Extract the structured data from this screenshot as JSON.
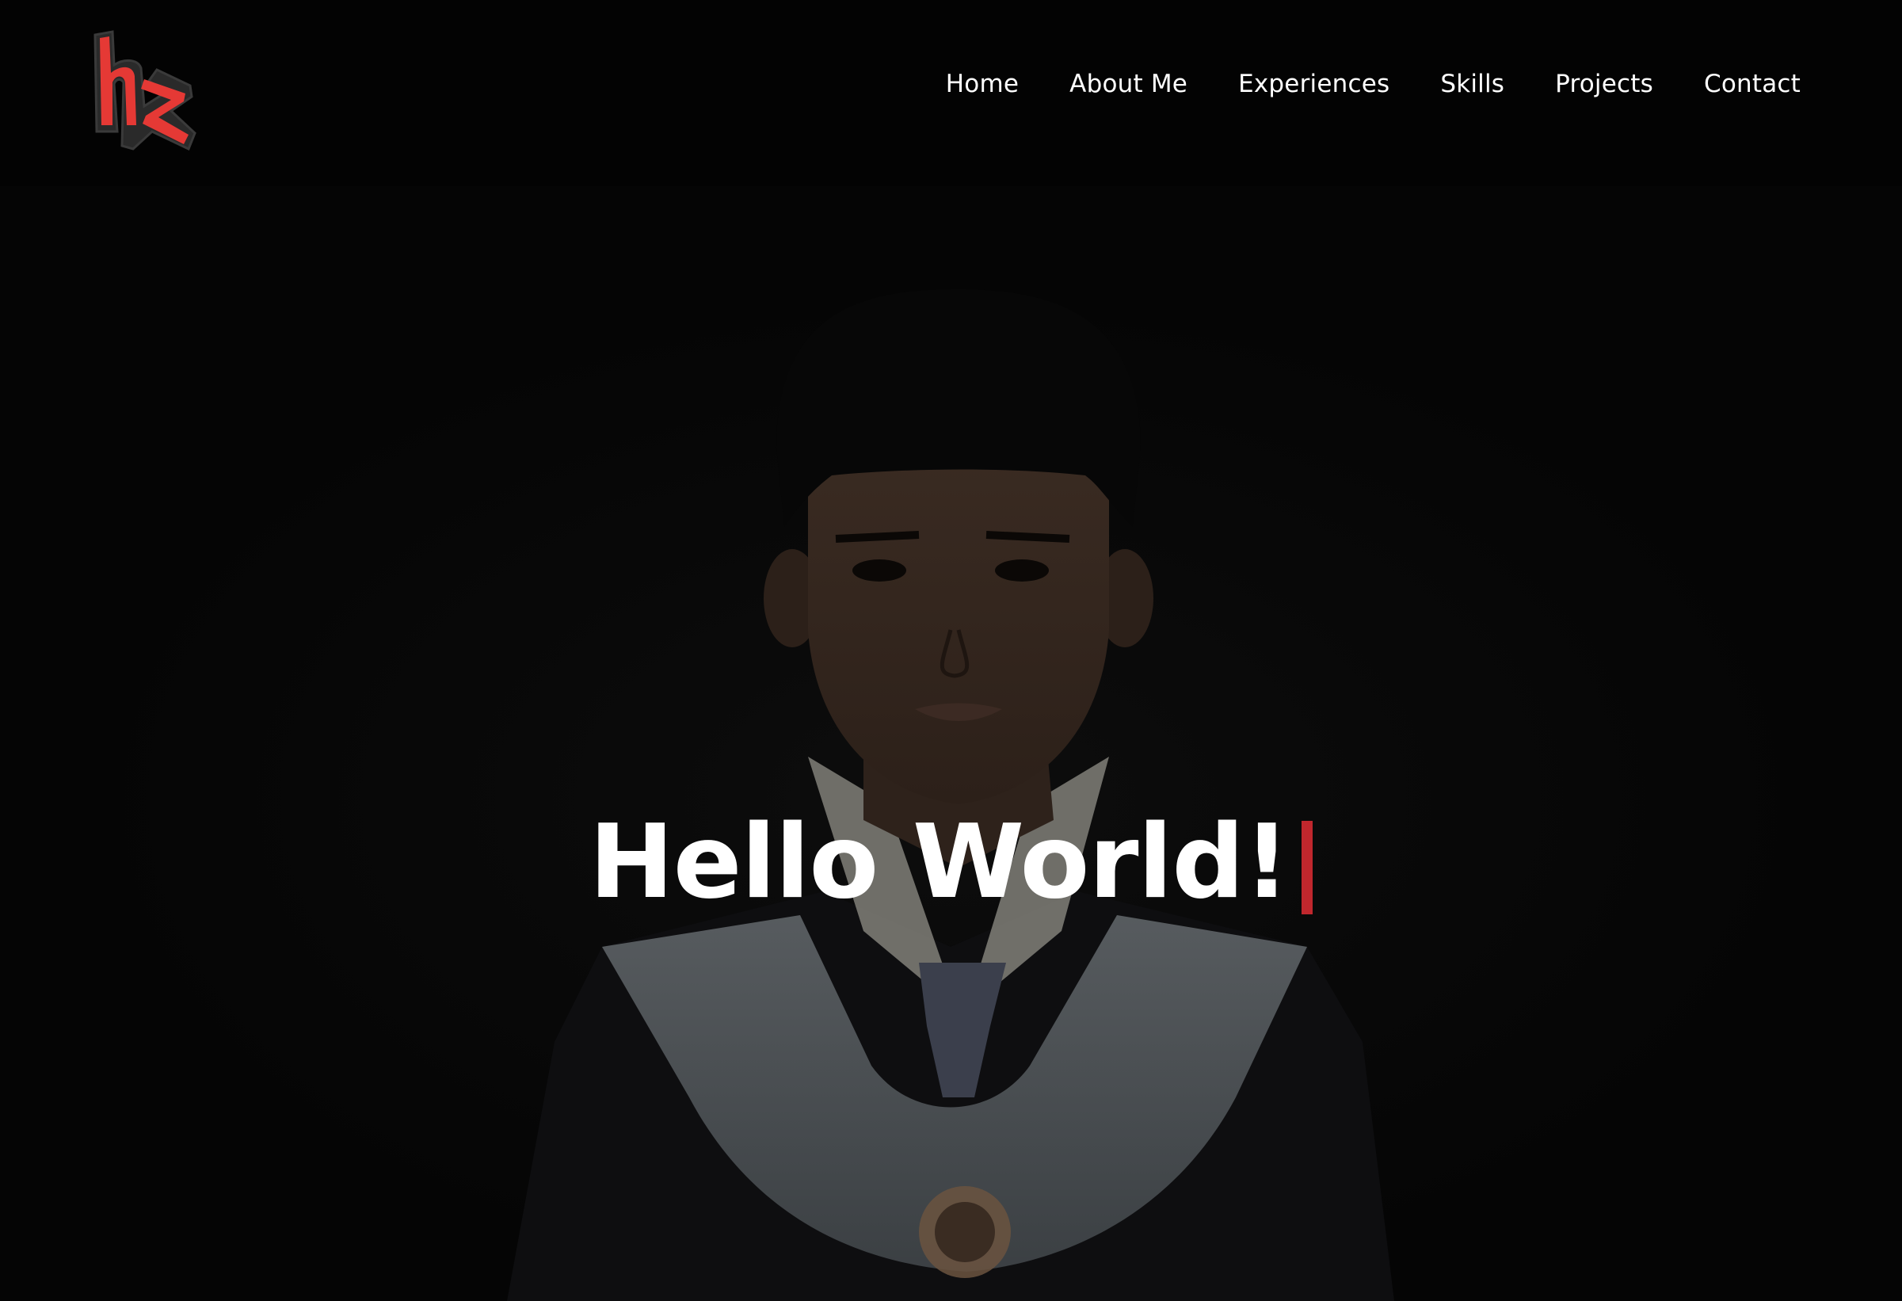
{
  "header": {
    "logo": {
      "text": "hz",
      "icon": "hz-monogram-logo",
      "color": "#e53935"
    },
    "nav": [
      {
        "label": "Home"
      },
      {
        "label": "About Me"
      },
      {
        "label": "Experiences"
      },
      {
        "label": "Skills"
      },
      {
        "label": "Projects"
      },
      {
        "label": "Contact"
      }
    ]
  },
  "hero": {
    "title": "Hello World!",
    "cursor_color": "#c0272d",
    "background_image": "graduation-portrait-photo"
  },
  "colors": {
    "background": "#050505",
    "text": "#ffffff",
    "accent": "#c0272d"
  }
}
